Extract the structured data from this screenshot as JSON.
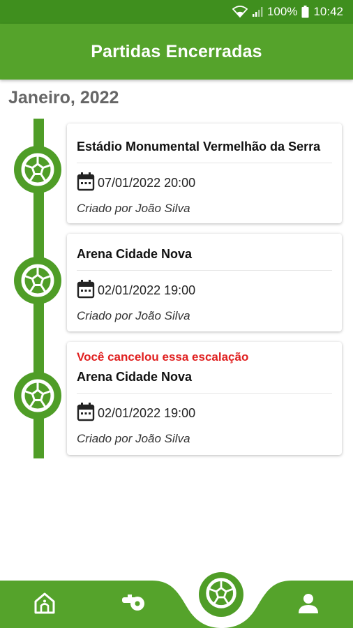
{
  "status_bar": {
    "battery": "100%",
    "time": "10:42"
  },
  "app_bar": {
    "title": "Partidas Encerradas"
  },
  "month_header": "Janeiro, 2022",
  "matches": [
    {
      "status": "",
      "venue": "Estádio Monumental Vermelhão da Serra",
      "datetime": "07/01/2022 20:00",
      "creator": "Criado por João Silva"
    },
    {
      "status": "",
      "venue": "Arena Cidade Nova",
      "datetime": "02/01/2022 19:00",
      "creator": "Criado por João Silva"
    },
    {
      "status": "Você cancelou essa escalação",
      "venue": "Arena Cidade Nova",
      "datetime": "02/01/2022 19:00",
      "creator": "Criado por João Silva"
    }
  ],
  "bottom_nav": {
    "items": [
      {
        "icon": "home-icon"
      },
      {
        "icon": "whistle-icon"
      },
      {
        "icon": "soccer-ball-icon"
      },
      {
        "icon": "profile-icon"
      }
    ]
  },
  "colors": {
    "primary": "#55a32b",
    "status_bar": "#3f8f1e",
    "timeline": "#4f9d27",
    "cancel": "#e02020"
  }
}
